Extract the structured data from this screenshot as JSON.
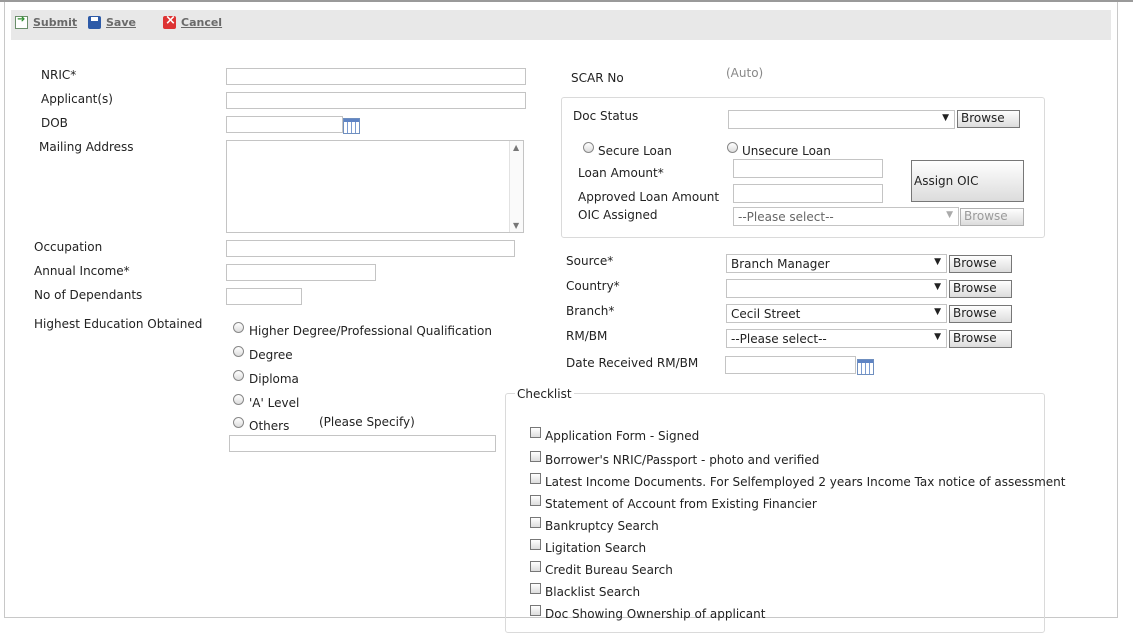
{
  "toolbar": {
    "submit_label": "Submit",
    "save_label": "Save",
    "cancel_label": "Cancel"
  },
  "left": {
    "nric_label": "NRIC*",
    "applicants_label": "Applicant(s)",
    "dob_label": "DOB",
    "mailing_label": "Mailing Address",
    "occupation_label": "Occupation",
    "income_label": "Annual Income*",
    "dependants_label": "No of Dependants",
    "education_label": "Highest Education Obtained",
    "education_options": [
      "Higher Degree/Professional Qualification",
      "Degree",
      "Diploma",
      "'A' Level",
      "Others"
    ],
    "please_specify": "(Please Specify)"
  },
  "right": {
    "scar_label": "SCAR No",
    "scar_value": "(Auto)",
    "doc_status_label": "Doc Status",
    "secure_loan_label": "Secure Loan",
    "unsecure_loan_label": "Unsecure Loan",
    "loan_amount_label": "Loan Amount*",
    "approved_label": "Approved Loan Amount",
    "oic_label": "OIC Assigned",
    "oic_placeholder": "--Please select--",
    "assign_oic_label": "Assign OIC",
    "source_label": "Source*",
    "source_value": "Branch Manager",
    "country_label": "Country*",
    "branch_label": "Branch*",
    "branch_value": "Cecil Street",
    "rm_label": "RM/BM",
    "rm_value": "--Please select--",
    "date_received_label": "Date Received RM/BM",
    "browse_label": "Browse"
  },
  "checklist": {
    "title": "Checklist",
    "items": [
      "Application Form - Signed",
      "Borrower's NRIC/Passport - photo and verified",
      "Latest Income Documents. For Selfemployed 2 years Income Tax notice of assessment",
      "Statement of Account from Existing Financier",
      "Bankruptcy Search",
      "Ligitation Search",
      "Credit Bureau Search",
      "Blacklist Search",
      "Doc Showing Ownership of applicant"
    ]
  },
  "icons": {
    "submit": "submit-icon",
    "save": "save-disk-icon",
    "cancel": "cancel-x-icon",
    "calendar": "calendar-icon"
  }
}
